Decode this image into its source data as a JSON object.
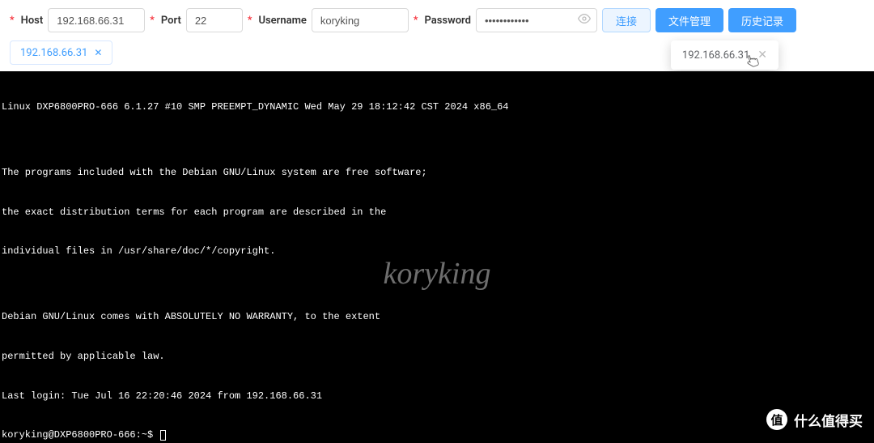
{
  "toolbar": {
    "host_label": "Host",
    "host_value": "192.168.66.31",
    "port_label": "Port",
    "port_value": "22",
    "username_label": "Username",
    "username_value": "koryking",
    "password_label": "Password",
    "password_value": "••••••••••••",
    "connect_label": "连接",
    "file_manager_label": "文件管理",
    "history_label": "历史记录"
  },
  "tabs": [
    {
      "label": "192.168.66.31"
    }
  ],
  "history_popup": {
    "item": "192.168.66.31"
  },
  "terminal": {
    "lines": [
      "Linux DXP6800PRO-666 6.1.27 #10 SMP PREEMPT_DYNAMIC Wed May 29 18:12:42 CST 2024 x86_64",
      "",
      "The programs included with the Debian GNU/Linux system are free software;",
      "the exact distribution terms for each program are described in the",
      "individual files in /usr/share/doc/*/copyright.",
      "",
      "Debian GNU/Linux comes with ABSOLUTELY NO WARRANTY, to the extent",
      "permitted by applicable law.",
      "Last login: Tue Jul 16 22:20:46 2024 from 192.168.66.31"
    ],
    "prompt": "koryking@DXP6800PRO-666:~$ "
  },
  "watermark": "koryking",
  "footer": {
    "badge": "值",
    "text": "什么值得买"
  }
}
